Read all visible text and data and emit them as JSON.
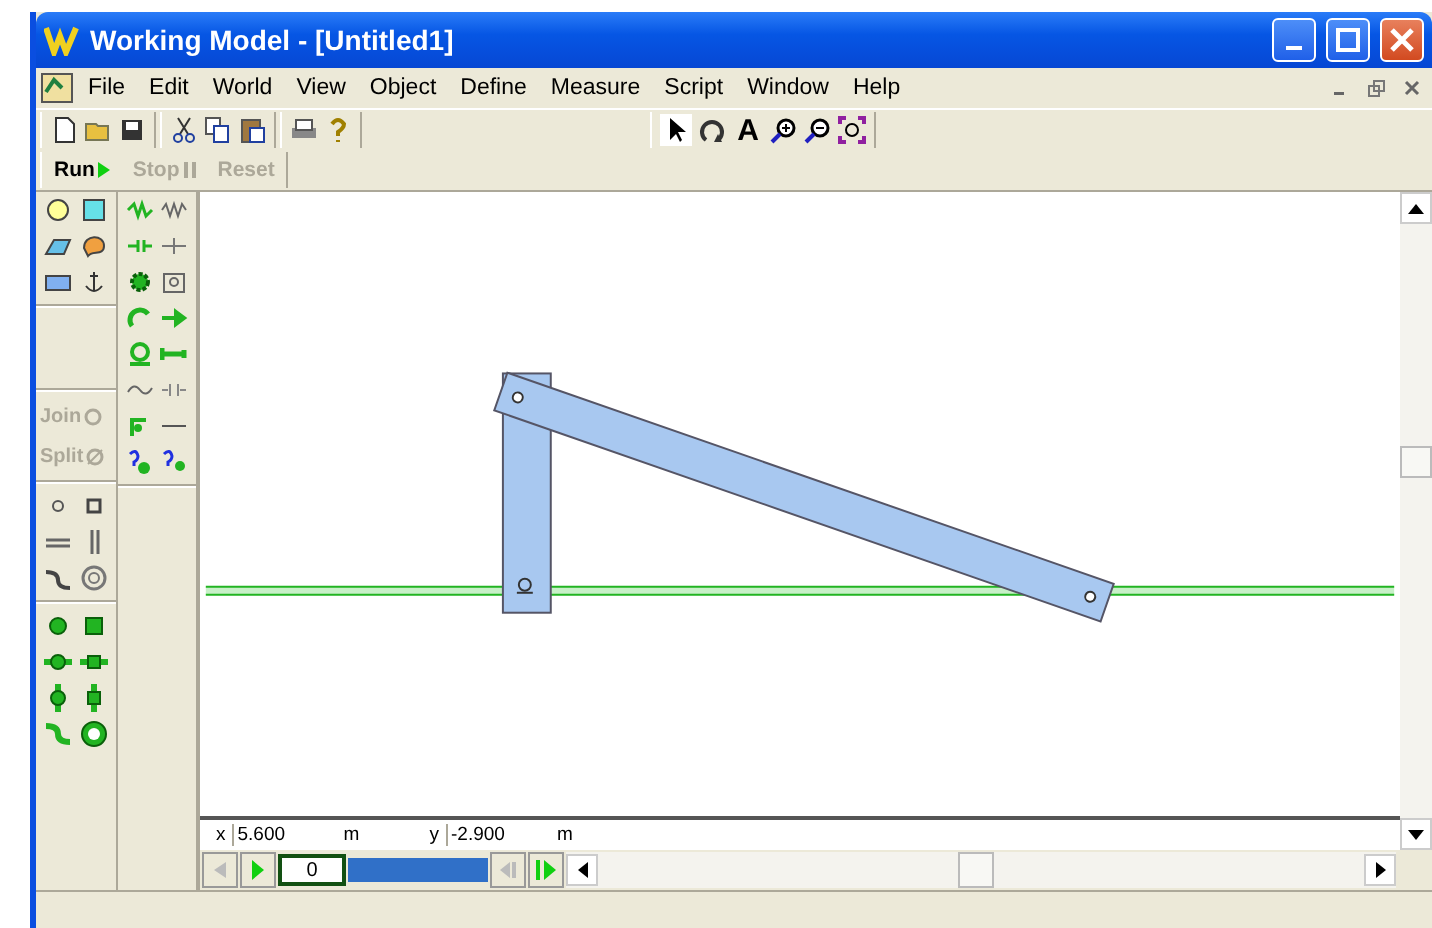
{
  "window": {
    "title": "Working Model - [Untitled1]"
  },
  "menu": [
    "File",
    "Edit",
    "World",
    "View",
    "Object",
    "Define",
    "Measure",
    "Script",
    "Window",
    "Help"
  ],
  "toolbar": {
    "text_tool": "A"
  },
  "run_bar": [
    {
      "label": "Run",
      "disabled": false
    },
    {
      "label": "Stop",
      "disabled": true
    },
    {
      "label": "Reset",
      "disabled": true
    }
  ],
  "palette": {
    "join": {
      "label": "Join",
      "disabled": true
    },
    "split": {
      "label": "Split",
      "disabled": true
    }
  },
  "coordinates": {
    "x_label": "x",
    "x_value": "5.600",
    "x_unit": "m",
    "y_label": "y",
    "y_value": "-2.900",
    "y_unit": "m"
  },
  "tape": {
    "frame": "0",
    "level": 1.0
  }
}
